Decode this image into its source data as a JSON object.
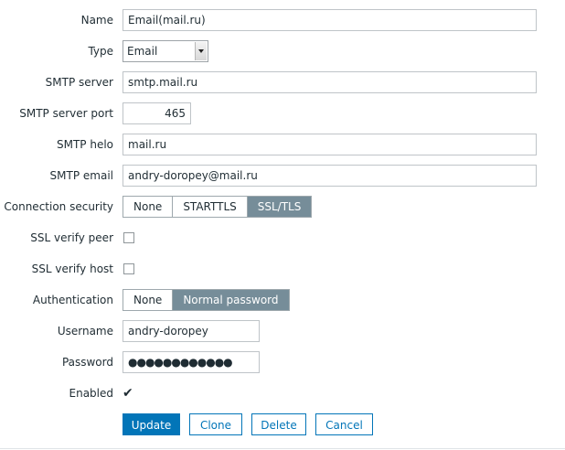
{
  "form": {
    "name": {
      "label": "Name",
      "value": "Email(mail.ru)"
    },
    "type": {
      "label": "Type",
      "value": "Email"
    },
    "smtp_server": {
      "label": "SMTP server",
      "value": "smtp.mail.ru"
    },
    "smtp_port": {
      "label": "SMTP server port",
      "value": "465"
    },
    "smtp_helo": {
      "label": "SMTP helo",
      "value": "mail.ru"
    },
    "smtp_email": {
      "label": "SMTP email",
      "value": "andry-doropey@mail.ru"
    },
    "connection_security": {
      "label": "Connection security",
      "options": [
        "None",
        "STARTTLS",
        "SSL/TLS"
      ],
      "selected": "SSL/TLS"
    },
    "ssl_verify_peer": {
      "label": "SSL verify peer",
      "checked": false
    },
    "ssl_verify_host": {
      "label": "SSL verify host",
      "checked": false
    },
    "authentication": {
      "label": "Authentication",
      "options": [
        "None",
        "Normal password"
      ],
      "selected": "Normal password"
    },
    "username": {
      "label": "Username",
      "value": "andry-doropey"
    },
    "password": {
      "label": "Password",
      "value": "●●●●●●●●●●●●"
    },
    "enabled": {
      "label": "Enabled",
      "checked": true,
      "glyph": "✔"
    }
  },
  "buttons": {
    "update": "Update",
    "clone": "Clone",
    "delete": "Delete",
    "cancel": "Cancel"
  },
  "colors": {
    "accent": "#0275b8",
    "segment_active": "#768d99"
  }
}
